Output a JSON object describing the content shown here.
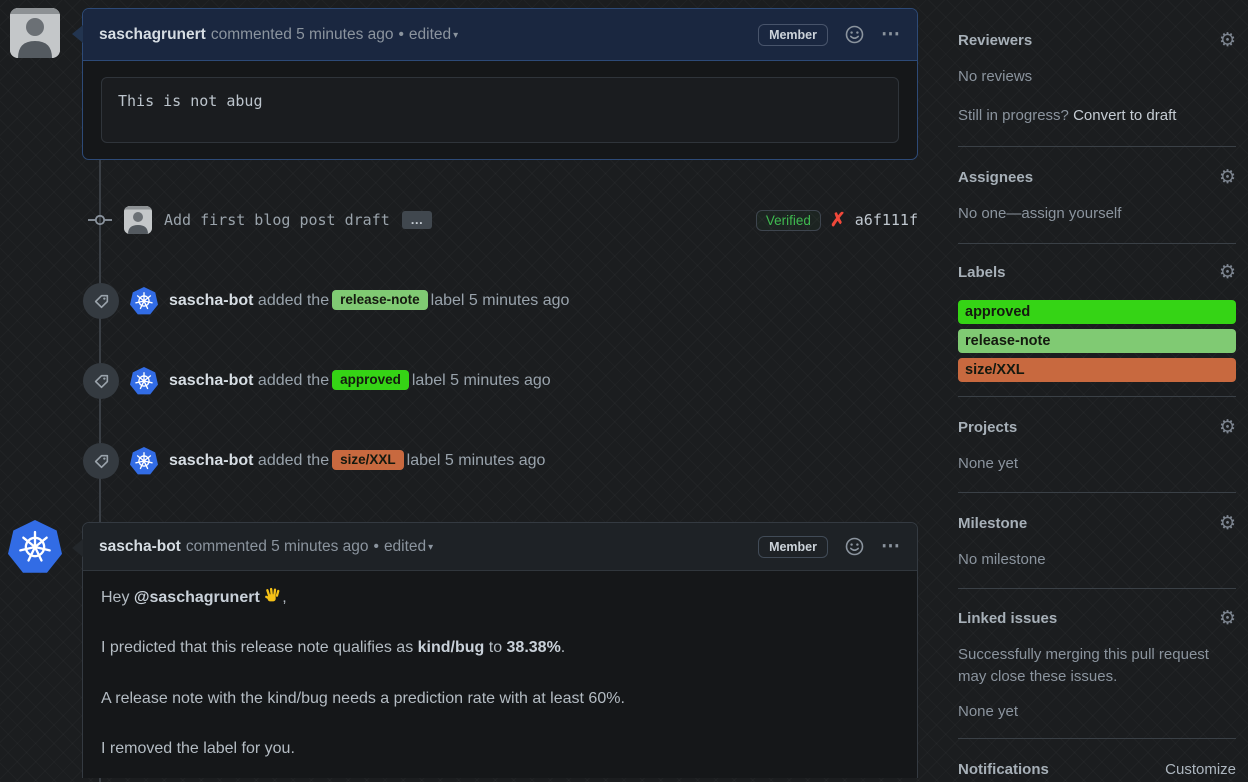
{
  "ui": {
    "bullet": "•",
    "caret": "▾",
    "kebab": "⋯",
    "ellipsis": "…"
  },
  "colors": {
    "approved": "#35d415",
    "release_note": "#80ca73",
    "size_xxl": "#c8693f",
    "verified_green": "#3fb950",
    "k8s_blue": "#326ce5"
  },
  "comment1": {
    "author": "saschagrunert",
    "action": "commented 5 minutes ago",
    "edited_label": "edited",
    "member_badge": "Member",
    "code": "This is not abug"
  },
  "commit": {
    "message": "Add first blog post draft",
    "verified_label": "Verified",
    "hash": "a6f111f"
  },
  "events": [
    {
      "actor": "sascha-bot",
      "pre": "added the",
      "label": "release-note",
      "post": "label 5 minutes ago"
    },
    {
      "actor": "sascha-bot",
      "pre": "added the",
      "label": "approved",
      "post": "label 5 minutes ago"
    },
    {
      "actor": "sascha-bot",
      "pre": "added the",
      "label": "size/XXL",
      "post": "label 5 minutes ago"
    }
  ],
  "comment2": {
    "author": "sascha-bot",
    "action": "commented 5 minutes ago",
    "edited_label": "edited",
    "member_badge": "Member",
    "p1_pre": "Hey ",
    "p1_mention": "@saschagrunert",
    "p1_post": ",",
    "p2_pre": "I predicted that this release note qualifies as ",
    "p2_bold1": "kind/bug",
    "p2_mid": " to ",
    "p2_bold2": "38.38%",
    "p2_post": ".",
    "p3": "A release note with the kind/bug needs a prediction rate with at least 60%.",
    "p4": "I removed the label for you."
  },
  "sidebar": {
    "reviewers": {
      "title": "Reviewers",
      "empty": "No reviews",
      "hint_pre": "Still in progress? ",
      "hint_link": "Convert to draft"
    },
    "assignees": {
      "title": "Assignees",
      "empty_pre": "No one—",
      "empty_link": "assign yourself"
    },
    "labels": {
      "title": "Labels",
      "items": [
        {
          "name": "approved"
        },
        {
          "name": "release-note"
        },
        {
          "name": "size/XXL"
        }
      ]
    },
    "projects": {
      "title": "Projects",
      "empty": "None yet"
    },
    "milestone": {
      "title": "Milestone",
      "empty": "No milestone"
    },
    "linked_issues": {
      "title": "Linked issues",
      "desc": "Successfully merging this pull request may close these issues.",
      "empty": "None yet"
    },
    "notifications": {
      "title": "Notifications",
      "customize": "Customize"
    }
  }
}
